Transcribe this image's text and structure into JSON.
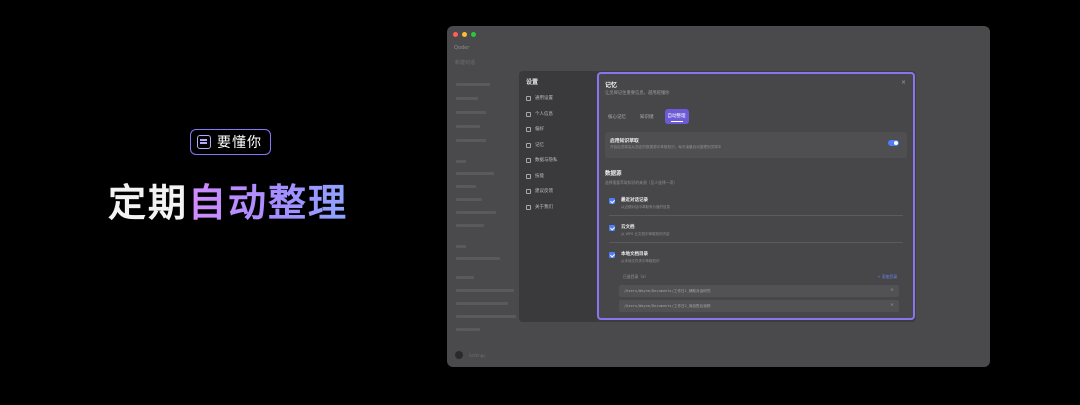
{
  "hero": {
    "badge": "要懂你",
    "badge_icon": "notebook-icon",
    "title_plain": "定期",
    "title_gradient": "自动整理",
    "accent_color": "#8f74f5"
  },
  "window": {
    "brand": "Qoder",
    "nav": [
      "新建对话",
      "",
      "",
      "",
      "",
      "",
      "",
      "",
      "",
      "",
      "",
      "",
      "",
      "",
      "",
      "",
      "",
      ""
    ],
    "footer": "Settings"
  },
  "settings": {
    "title": "设置",
    "items": [
      {
        "label": "通用设置",
        "icon": "gear-icon"
      },
      {
        "label": "个人信息",
        "icon": "user-icon"
      },
      {
        "label": "偏好",
        "icon": "link-icon"
      },
      {
        "label": "记忆",
        "icon": "memory-icon"
      },
      {
        "label": "数据与隐私",
        "icon": "lock-icon"
      },
      {
        "label": "技能",
        "icon": "skill-icon"
      },
      {
        "label": "建议反馈",
        "icon": "code-icon"
      },
      {
        "label": "关于我们",
        "icon": "info-icon"
      }
    ]
  },
  "panel": {
    "title": "记忆",
    "subtitle": "让灵犀记住重要信息，越用越懂你",
    "close": "×",
    "tabs": [
      "核心记忆",
      "知识储",
      "自动整理"
    ],
    "active_tab": "自动整理",
    "auto_card": {
      "title": "启用知识萃取",
      "desc": "开启后灵犀会从选定的数据源中萃取知识，每天凌晨自动整理到灵犀中",
      "enabled": true
    },
    "sources_title": "数据源",
    "sources_desc": "选择需要萃取知识的来源（至少选择一项）",
    "sources": [
      {
        "title": "最近对话记录",
        "desc": "从近期对话中萃取有价值的信息",
        "checked": true
      },
      {
        "title": "云文档",
        "desc": "从 WPS 云文档中萃取知识内容",
        "checked": true
      },
      {
        "title": "本地文档目录",
        "desc": "从本地文件夹中萃取知识",
        "checked": true
      }
    ],
    "dir_label": "已选目录（5）",
    "dir_add": "+ 添加目录",
    "dirs": [
      "/Users/Wayne/Documents/工作日1_辅助对话研究",
      "/Users/Wayne/Documents/工作日2_商品售后追踪"
    ]
  }
}
